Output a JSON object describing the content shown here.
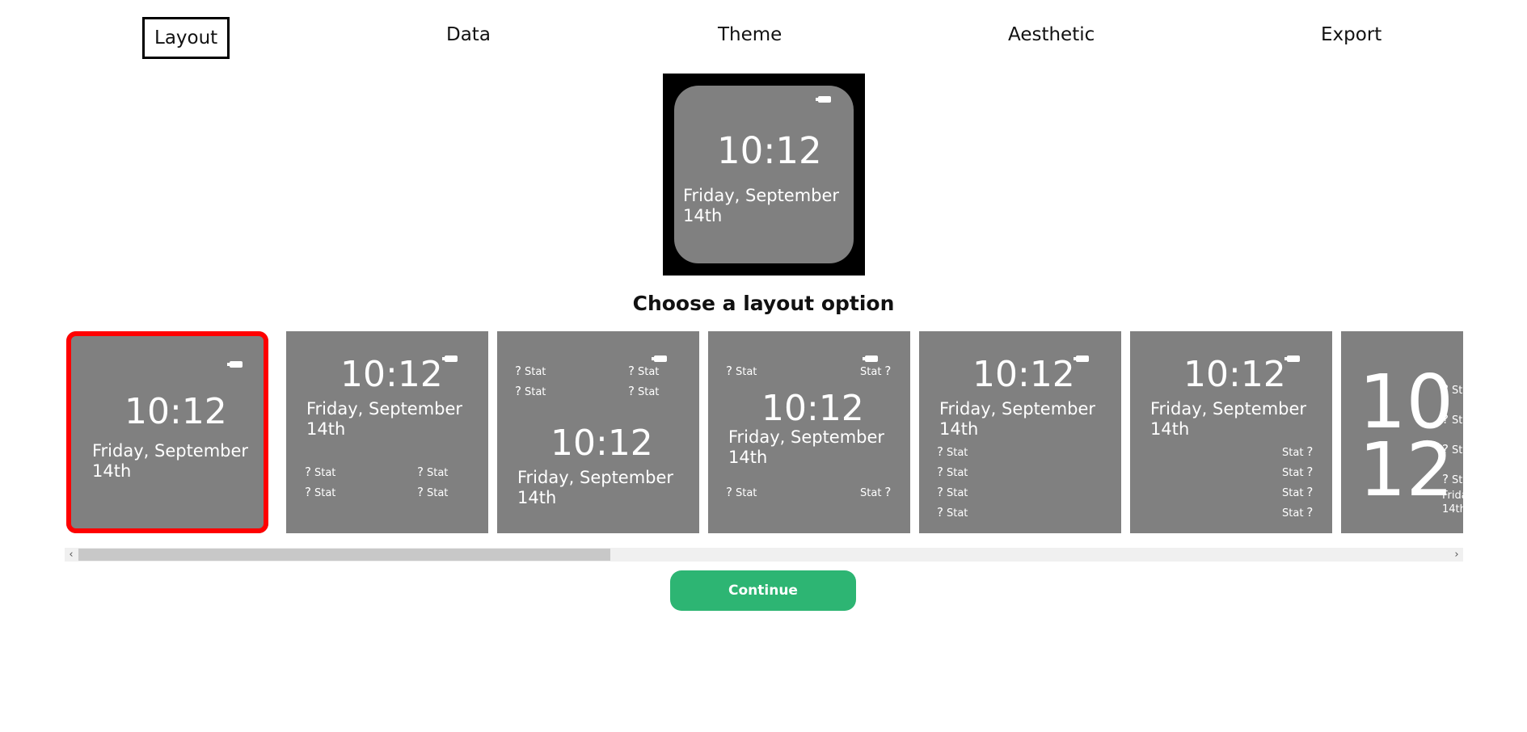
{
  "nav": {
    "tabs": [
      {
        "label": "Layout",
        "active": true
      },
      {
        "label": "Data"
      },
      {
        "label": "Theme"
      },
      {
        "label": "Aesthetic"
      },
      {
        "label": "Export"
      }
    ]
  },
  "preview": {
    "time": "10:12",
    "date": "Friday, September 14th",
    "icon": "battery-icon"
  },
  "heading": "Choose a layout option",
  "layouts": {
    "time": "10:12",
    "date": "Friday, September 14th",
    "stat_label": "Stat",
    "stat_glyph": "?",
    "big_hour": "10",
    "big_minute": "12",
    "big_date_line1": "Frida",
    "big_date_line2": "14th",
    "selected_index": 0
  },
  "scrollbar": {
    "left_arrow": "‹",
    "right_arrow": "›",
    "position": 0.38
  },
  "continue_label": "Continue",
  "colors": {
    "accent": "#2db573",
    "selected_border": "#ff0000",
    "watch_face": "#808080"
  }
}
